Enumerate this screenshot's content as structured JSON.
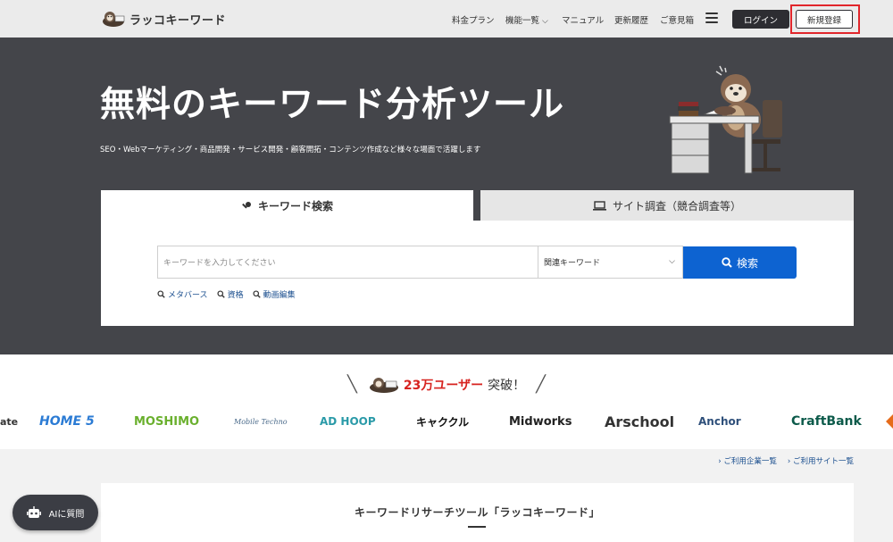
{
  "header": {
    "logo_text": "ラッコキーワード",
    "nav": [
      {
        "label": "料金プラン"
      },
      {
        "label": "機能一覧",
        "has_dropdown": true
      },
      {
        "label": "マニュアル"
      },
      {
        "label": "更新履歴"
      },
      {
        "label": "ご意見箱"
      }
    ],
    "menu_icon": "hamburger-icon",
    "login_label": "ログイン",
    "signup_label": "新規登録"
  },
  "hero": {
    "title": "無料のキーワード分析ツール",
    "subtitle": "SEO・Webマーケティング・商品開発・サービス開発・顧客開拓・コンテンツ作成など様々な場面で活躍します"
  },
  "search": {
    "tabs": [
      {
        "label": "キーワード検索",
        "icon": "key-icon",
        "active": true
      },
      {
        "label": "サイト調査（競合調査等）",
        "icon": "laptop-icon",
        "active": false
      }
    ],
    "placeholder": "キーワードを入力してください",
    "select_value": "関連キーワード",
    "button_label": "検索",
    "suggestions": [
      "メタバース",
      "資格",
      "動画編集"
    ]
  },
  "users": {
    "count": "23万ユーザー",
    "suffix": "突破！"
  },
  "logos": [
    "ate",
    "HOME 5",
    "MOSHIMO",
    "Mobile Techno",
    "AD HOOP",
    "キャククル",
    "Midworks",
    "Arschool",
    "Anchor",
    "CraftBank"
  ],
  "links": [
    "ご利用企業一覧",
    "ご利用サイト一覧"
  ],
  "section_title": "キーワードリサーチツール「ラッコキーワード」",
  "ai_button_label": "AIに質問",
  "colors": {
    "hero_bg": "#44454a",
    "primary": "#0d63d1",
    "accent_red": "#d7231f",
    "header_bg": "#ebebeb"
  }
}
